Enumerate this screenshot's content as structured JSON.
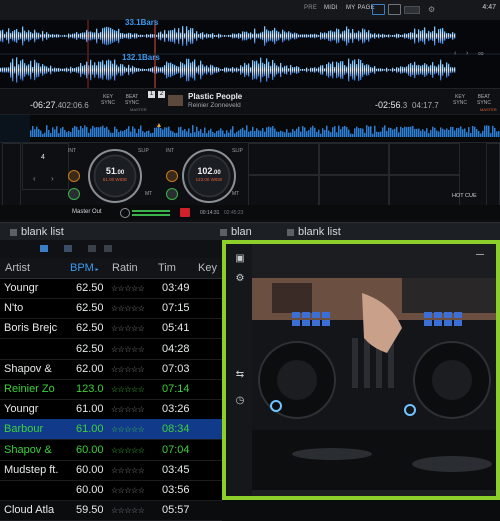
{
  "topbar": {
    "items": [
      "PRE",
      "MIDI",
      "MY PAGE"
    ],
    "clock": "4:47"
  },
  "waveform": {
    "bars_top": "33.1Bars",
    "bars_bottom": "132.1Bars"
  },
  "deck_left": {
    "number": "1",
    "time_remaining": "-06:27",
    "time_remaining_frac": ".4",
    "time_elapsed": "02:06",
    "time_elapsed_frac": ".6",
    "key_sync_label": "KEY SYNC",
    "beat_sync_label": "BEAT SYNC",
    "master_label": "MASTER",
    "panel_number": "4",
    "bpm": "51",
    "bpm_frac": ".00",
    "sub": "61.00 WIDE"
  },
  "deck_right": {
    "number": "2",
    "title": "Plastic People",
    "artist": "Reinier Zonneveld",
    "time_remaining": "-02:56",
    "time_remaining_frac": ".3",
    "time_elapsed": "04:17",
    "time_elapsed_frac": ".7",
    "key_sync_label": "KEY SYNC",
    "beat_sync_label": "BEAT SYNC",
    "master_label": "MASTER",
    "bpm": "102",
    "bpm_frac": ".00",
    "sub": "123.00 WIDE"
  },
  "status": {
    "master_out": "Master Out",
    "time_a": "00:14:31",
    "time_b": "02:45:23",
    "hot_cue": "HOT CUE"
  },
  "tabs": [
    {
      "label": "blank list"
    },
    {
      "label": "blan"
    },
    {
      "label": "blank list"
    }
  ],
  "list": {
    "columns": [
      "Artist",
      "BPM",
      "Ratin",
      "Tim",
      "Key"
    ],
    "rows": [
      {
        "artist": "Youngr",
        "bpm": "62.50",
        "rating": "☆☆☆☆☆",
        "time": "03:49",
        "style": ""
      },
      {
        "artist": "N'to",
        "bpm": "62.50",
        "rating": "☆☆☆☆☆",
        "time": "07:15",
        "style": ""
      },
      {
        "artist": "Boris Brejc",
        "bpm": "62.50",
        "rating": "☆☆☆☆☆",
        "time": "05:41",
        "style": ""
      },
      {
        "artist": "",
        "bpm": "62.50",
        "rating": "☆☆☆☆☆",
        "time": "04:28",
        "style": ""
      },
      {
        "artist": "Shapov &",
        "bpm": "62.00",
        "rating": "☆☆☆☆☆",
        "time": "07:03",
        "style": ""
      },
      {
        "artist": "Reinier Zo",
        "bpm": "123.0",
        "rating": "☆☆☆☆☆",
        "time": "07:14",
        "style": "green"
      },
      {
        "artist": "Youngr",
        "bpm": "61.00",
        "rating": "☆☆☆☆☆",
        "time": "03:26",
        "style": ""
      },
      {
        "artist": "Barbour",
        "bpm": "61.00",
        "rating": "☆☆☆☆☆",
        "time": "08:34",
        "style": "sel"
      },
      {
        "artist": "Shapov &",
        "bpm": "60.00",
        "rating": "☆☆☆☆☆",
        "time": "07:04",
        "style": "green"
      },
      {
        "artist": "Mudstep ft.",
        "bpm": "60.00",
        "rating": "☆☆☆☆☆",
        "time": "03:45",
        "style": ""
      },
      {
        "artist": "",
        "bpm": "60.00",
        "rating": "☆☆☆☆☆",
        "time": "03:56",
        "style": ""
      },
      {
        "artist": "Cloud Atla",
        "bpm": "59.50",
        "rating": "☆☆☆☆☆",
        "time": "05:57",
        "style": ""
      }
    ]
  },
  "icons": {
    "camera": "camera-icon",
    "settings": "gear-icon",
    "mirror": "mirror-icon",
    "timer": "timer-icon"
  },
  "colors": {
    "accent_blue": "#3a9bf0",
    "played_green": "#3bd13b",
    "selection": "#123a8a",
    "camera_border": "#8ccf2b",
    "record_red": "#d0212a"
  }
}
